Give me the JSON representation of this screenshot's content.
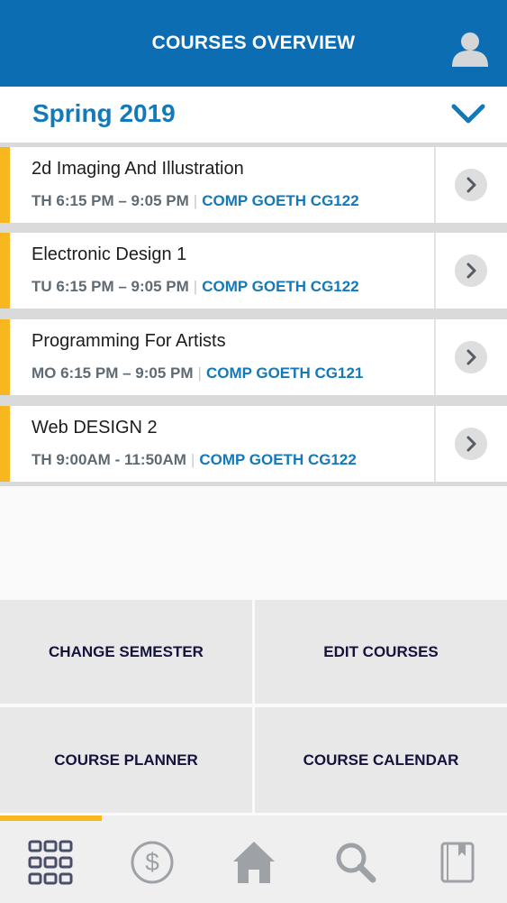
{
  "header": {
    "title": "COURSES OVERVIEW",
    "profile_icon": "user-icon"
  },
  "semester": {
    "label": "Spring 2019",
    "toggle_icon": "chevron-down-icon"
  },
  "courses": [
    {
      "name": "2d Imaging And Illustration",
      "time": "TH 6:15 PM – 9:05 PM",
      "room": "COMP GOETH CG122"
    },
    {
      "name": "Electronic Design 1",
      "time": "TU 6:15 PM – 9:05 PM",
      "room": "COMP GOETH CG122"
    },
    {
      "name": "Programming For Artists",
      "time": "MO 6:15 PM – 9:05 PM",
      "room": "COMP GOETH CG121"
    },
    {
      "name": "Web DESIGN 2",
      "time": "TH 9:00AM - 11:50AM",
      "room": "COMP GOETH CG122"
    }
  ],
  "actions": {
    "change_semester": "CHANGE SEMESTER",
    "edit_courses": "EDIT COURSES",
    "course_planner": "COURSE PLANNER",
    "course_calendar": "COURSE CALENDAR"
  },
  "tabs": [
    {
      "icon": "grid-icon",
      "active": true
    },
    {
      "icon": "dollar-icon",
      "active": false
    },
    {
      "icon": "home-icon",
      "active": false
    },
    {
      "icon": "search-icon",
      "active": false
    },
    {
      "icon": "book-icon",
      "active": false
    }
  ],
  "colors": {
    "brand_blue": "#0d6db3",
    "link_blue": "#1479b8",
    "accent_yellow": "#f7b71e",
    "action_text": "#15123d"
  }
}
